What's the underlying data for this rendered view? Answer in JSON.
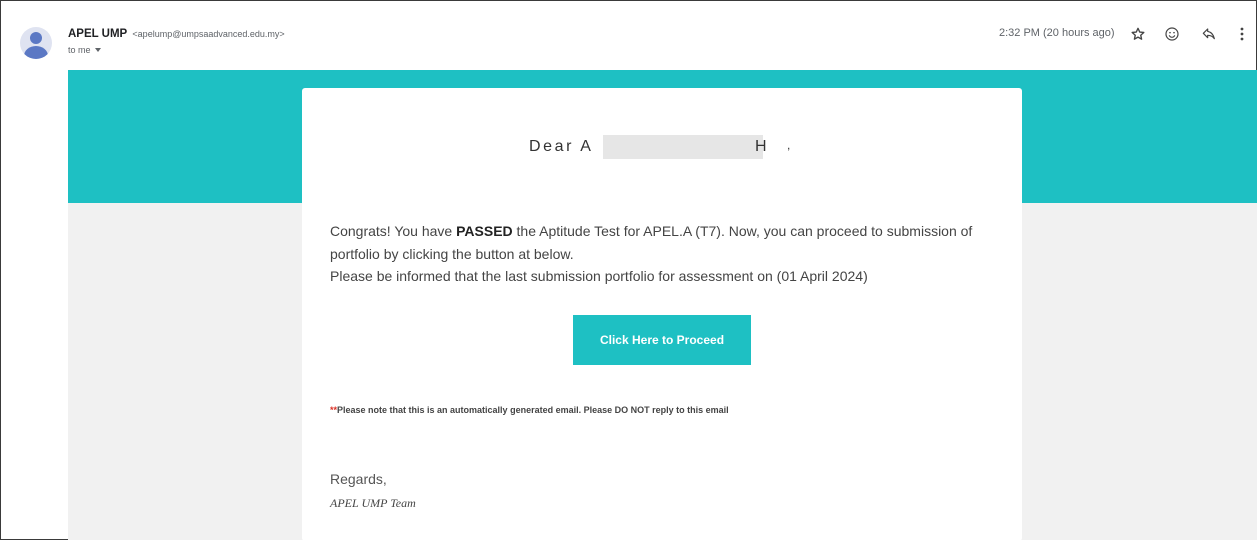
{
  "header": {
    "sender_name": "APEL UMP",
    "sender_email": "<apelump@umpsaadvanced.edu.my>",
    "recipient": "to me",
    "timestamp": "2:32 PM (20 hours ago)",
    "icons": [
      "star-icon",
      "emoji-icon",
      "reply-icon",
      "more-vert-icon"
    ]
  },
  "email": {
    "greeting_prefix": "Dear A",
    "greeting_suffix": "H",
    "greeting_comma": ",",
    "line1_a": "Congrats! You have ",
    "line1_bold": "PASSED",
    "line1_b": " the Aptitude Test for APEL.A (T7). Now, you can proceed to submission of",
    "line2": "portfolio by clicking the button at below.",
    "line3": "Please be informed that the last submission portfolio for assessment on (01 April 2024)",
    "button_label": "Click Here to Proceed",
    "note_stars": "**",
    "note_text": "Please note that this is an automatically generated email. Please DO NOT reply to this email",
    "regards": "Regards,",
    "signature": "APEL UMP Team"
  },
  "colors": {
    "accent_teal": "#1ec0c3",
    "body_grey": "#f1f1f1",
    "note_red": "#d93025",
    "avatar_blue": "#5b78c4"
  }
}
